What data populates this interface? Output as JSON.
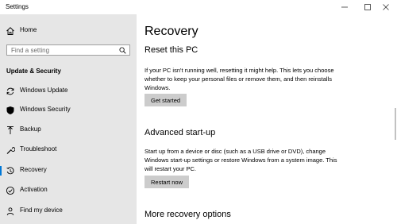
{
  "window": {
    "title": "Settings",
    "controls": {
      "minimize_icon": "minimize-icon",
      "maximize_icon": "maximize-icon",
      "close_icon": "close-icon"
    }
  },
  "sidebar": {
    "home": {
      "label": "Home",
      "icon": "home-icon"
    },
    "search": {
      "placeholder": "Find a setting",
      "icon": "search-icon"
    },
    "section_title": "Update & Security",
    "items": [
      {
        "label": "Windows Update",
        "icon": "sync-icon",
        "active": false
      },
      {
        "label": "Windows Security",
        "icon": "shield-icon",
        "active": false
      },
      {
        "label": "Backup",
        "icon": "upload-icon",
        "active": false
      },
      {
        "label": "Troubleshoot",
        "icon": "wrench-icon",
        "active": false
      },
      {
        "label": "Recovery",
        "icon": "recovery-icon",
        "active": true
      },
      {
        "label": "Activation",
        "icon": "check-circle-icon",
        "active": false
      },
      {
        "label": "Find my device",
        "icon": "person-pin-icon",
        "active": false
      }
    ],
    "active_color": "#0078d7"
  },
  "main": {
    "title": "Recovery",
    "reset": {
      "heading": "Reset this PC",
      "description": "If your PC isn't running well, resetting it might help. This lets you choose whether to keep your personal files or remove them, and then reinstalls Windows.",
      "button": "Get started"
    },
    "advanced": {
      "heading": "Advanced start-up",
      "description": "Start up from a device or disc (such as a USB drive or DVD), change Windows start-up settings or restore Windows from a system image. This will restart your PC.",
      "button": "Restart now"
    },
    "more": {
      "heading": "More recovery options"
    }
  }
}
